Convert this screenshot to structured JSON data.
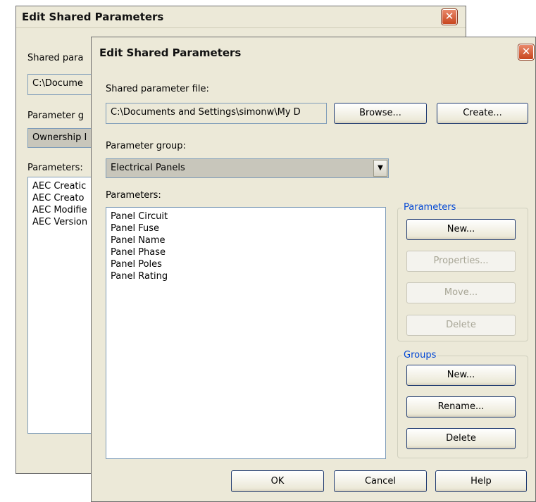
{
  "back_dialog": {
    "title": "Edit Shared Parameters",
    "close_glyph": "✕",
    "shared_file_label": "Shared para",
    "shared_file_value": "C:\\Docume",
    "group_label": "Parameter g",
    "group_value": "Ownership I",
    "params_label": "Parameters:",
    "params": [
      "AEC Creatic",
      "AEC Creato",
      "AEC Modifie",
      "AEC Version"
    ]
  },
  "front_dialog": {
    "title": "Edit Shared Parameters",
    "close_glyph": "✕",
    "shared_file_label": "Shared parameter file:",
    "shared_file_value": "C:\\Documents and Settings\\simonw\\My D",
    "browse_label": "Browse...",
    "create_label": "Create...",
    "group_label": "Parameter group:",
    "group_value": "Electrical Panels",
    "params_label": "Parameters:",
    "params": [
      "Panel Circuit",
      "Panel Fuse",
      "Panel Name",
      "Panel Phase",
      "Panel Poles",
      "Panel Rating"
    ],
    "parameters_group": {
      "legend": "Parameters",
      "new_label": "New...",
      "properties_label": "Properties...",
      "move_label": "Move...",
      "delete_label": "Delete"
    },
    "groups_group": {
      "legend": "Groups",
      "new_label": "New...",
      "rename_label": "Rename...",
      "delete_label": "Delete"
    },
    "ok_label": "OK",
    "cancel_label": "Cancel",
    "help_label": "Help"
  }
}
